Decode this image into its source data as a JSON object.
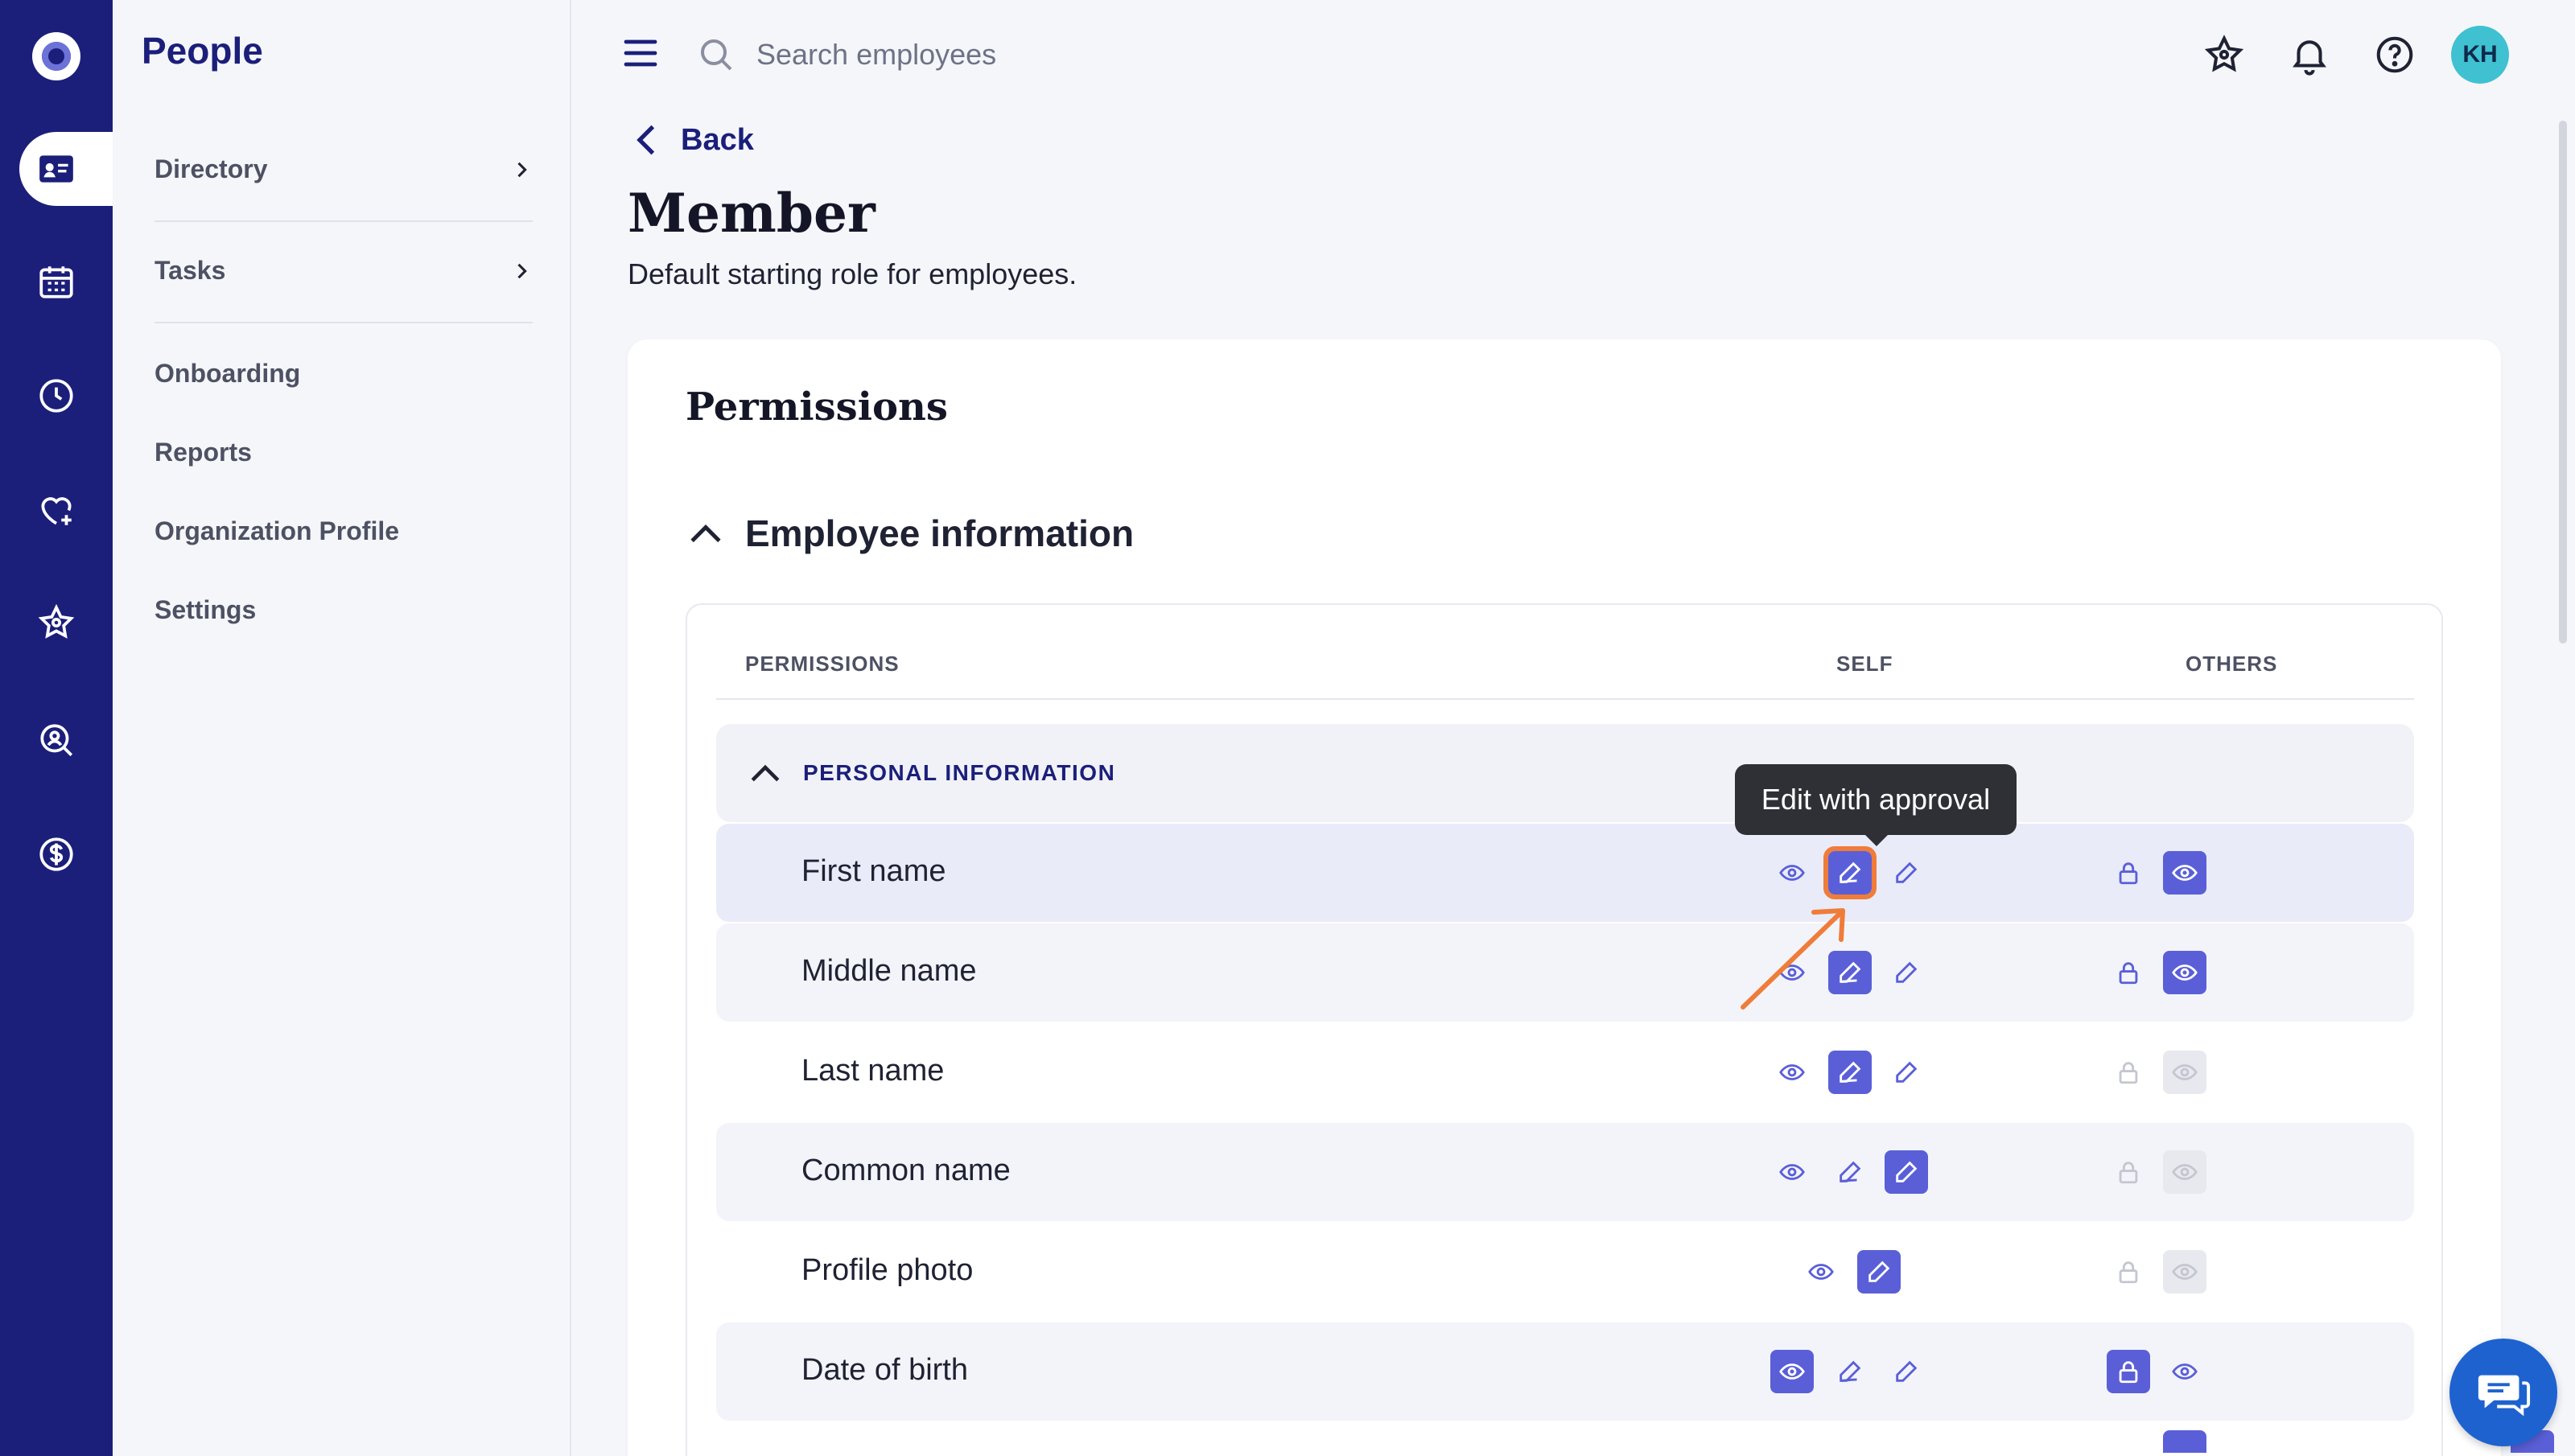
{
  "app": {
    "title": "People"
  },
  "subnav": {
    "items": [
      {
        "label": "Directory",
        "has_children": true
      },
      {
        "label": "Tasks",
        "has_children": true
      },
      {
        "label": "Onboarding"
      },
      {
        "label": "Reports"
      },
      {
        "label": "Organization Profile"
      },
      {
        "label": "Settings"
      }
    ]
  },
  "rail": {
    "icons": [
      "logo-icon",
      "people-card-icon",
      "calendar-icon",
      "clock-icon",
      "heart-plus-icon",
      "star-icon",
      "search-person-icon",
      "dollar-icon"
    ],
    "active": "people-card-icon"
  },
  "topbar": {
    "search_placeholder": "Search employees",
    "avatar_initials": "KH"
  },
  "header": {
    "back_label": "Back",
    "title": "Member",
    "subtitle": "Default starting role for employees."
  },
  "card": {
    "title": "Permissions",
    "section_title": "Employee information",
    "columns": {
      "permissions": "PERMISSIONS",
      "self": "SELF",
      "others": "OTHERS"
    },
    "group_title": "PERSONAL INFORMATION",
    "tooltip": "Edit with approval",
    "rows": [
      {
        "label": "First name",
        "self": "edit-with-approval",
        "others": "view",
        "others_enabled": true
      },
      {
        "label": "Middle name",
        "self": "edit-with-approval",
        "others": "view",
        "others_enabled": true
      },
      {
        "label": "Last name",
        "self": "edit-with-approval",
        "others": "view",
        "others_enabled": false
      },
      {
        "label": "Common name",
        "self": "edit",
        "others": "view",
        "others_enabled": false
      },
      {
        "label": "Profile photo",
        "self": "edit",
        "others": "view",
        "others_enabled": false
      },
      {
        "label": "Date of birth",
        "self": "view",
        "others": "locked",
        "others_enabled": true
      }
    ]
  },
  "colors": {
    "brand_navy": "#1b1f7a",
    "accent": "#5a5fd8",
    "highlight_outline": "#f07c3a",
    "avatar": "#3fc1d1",
    "chat": "#1e62d0"
  }
}
